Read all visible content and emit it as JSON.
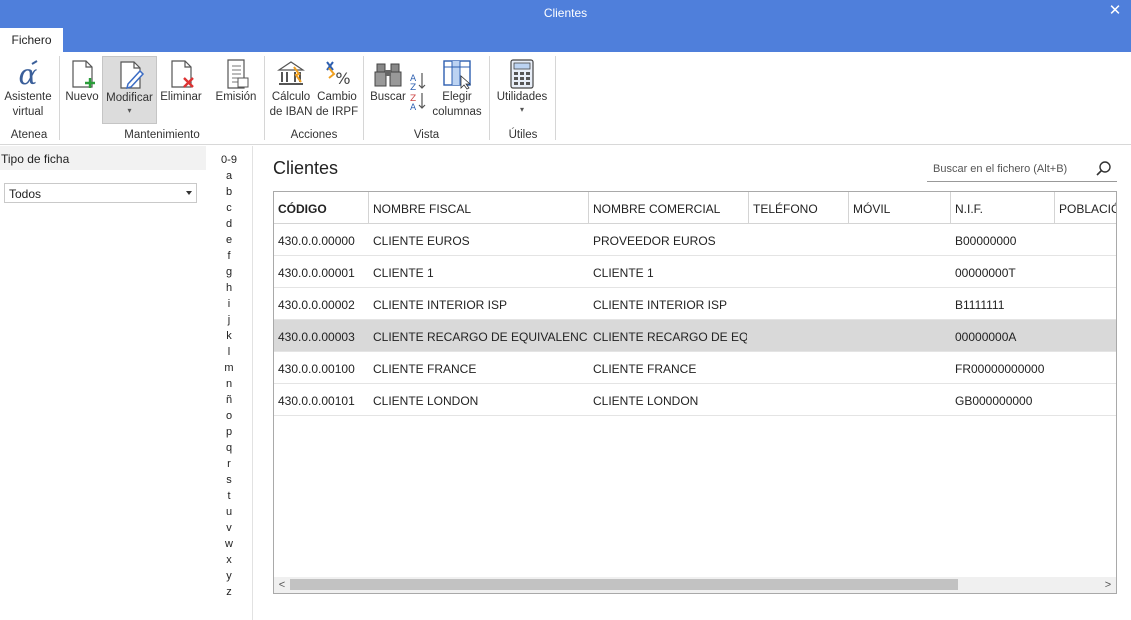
{
  "window": {
    "title": "Clientes",
    "close_glyph": "✕"
  },
  "tabs": [
    {
      "label": "Fichero"
    }
  ],
  "ribbon": {
    "groups": [
      {
        "label": "Atenea"
      },
      {
        "label": "Mantenimiento"
      },
      {
        "label": "Acciones"
      },
      {
        "label": "Vista"
      },
      {
        "label": "Útiles"
      }
    ],
    "buttons": {
      "asistente": [
        "Asistente",
        "virtual"
      ],
      "nuevo": "Nuevo",
      "modificar": "Modificar",
      "eliminar": "Eliminar",
      "emision": "Emisión",
      "iban": [
        "Cálculo",
        "de IBAN"
      ],
      "irpf": [
        "Cambio",
        "de IRPF"
      ],
      "buscar": "Buscar",
      "elegir": [
        "Elegir",
        "columnas"
      ],
      "utilidades": "Utilidades",
      "dropdown_glyph": "▾"
    }
  },
  "left_panel": {
    "header": "Tipo de ficha",
    "select_value": "Todos"
  },
  "alphabet": [
    "0-9",
    "a",
    "b",
    "c",
    "d",
    "e",
    "f",
    "g",
    "h",
    "i",
    "j",
    "k",
    "l",
    "m",
    "n",
    "ñ",
    "o",
    "p",
    "q",
    "r",
    "s",
    "t",
    "u",
    "v",
    "w",
    "x",
    "y",
    "z"
  ],
  "main": {
    "title": "Clientes",
    "search_placeholder": "Buscar en el fichero (Alt+B)"
  },
  "table": {
    "columns": [
      "CÓDIGO",
      "NOMBRE FISCAL",
      "NOMBRE COMERCIAL",
      "TELÉFONO",
      "MÓVIL",
      "N.I.F.",
      "POBLACIÓ"
    ],
    "rows": [
      [
        "430.0.0.00000",
        "CLIENTE EUROS",
        "PROVEEDOR EUROS",
        "",
        "",
        "B00000000",
        ""
      ],
      [
        "430.0.0.00001",
        "CLIENTE 1",
        "CLIENTE 1",
        "",
        "",
        "00000000T",
        ""
      ],
      [
        "430.0.0.00002",
        "CLIENTE INTERIOR ISP",
        "CLIENTE INTERIOR ISP",
        "",
        "",
        "B1111111",
        ""
      ],
      [
        "430.0.0.00003",
        "CLIENTE RECARGO DE EQUIVALENCIA",
        "CLIENTE RECARGO DE EQU...",
        "",
        "",
        "00000000A",
        ""
      ],
      [
        "430.0.0.00100",
        "CLIENTE FRANCE",
        "CLIENTE FRANCE",
        "",
        "",
        "FR00000000000",
        ""
      ],
      [
        "430.0.0.00101",
        "CLIENTE LONDON",
        "CLIENTE LONDON",
        "",
        "",
        "GB000000000",
        ""
      ]
    ],
    "selected_row": 3
  },
  "scrollbar": {
    "left_glyph": "<",
    "right_glyph": ">"
  },
  "colors": {
    "accent": "#4f7fdb",
    "selected_row": "#d9d9d9"
  }
}
